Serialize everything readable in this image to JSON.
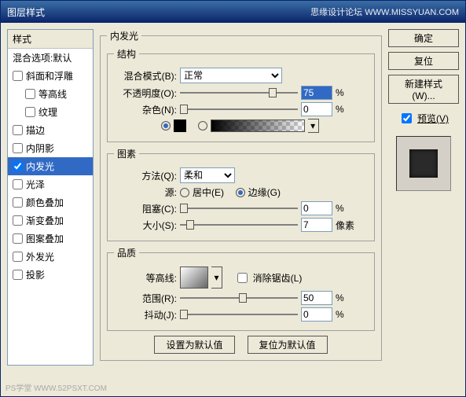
{
  "title": "图层样式",
  "title_right": "思缘设计论坛  WWW.MISSYUAN.COM",
  "styles_header": "样式",
  "blend_options": "混合选项:默认",
  "style_items": [
    {
      "label": "斜面和浮雕",
      "checked": false,
      "indent": false
    },
    {
      "label": "等高线",
      "checked": false,
      "indent": true
    },
    {
      "label": "纹理",
      "checked": false,
      "indent": true
    },
    {
      "label": "描边",
      "checked": false,
      "indent": false
    },
    {
      "label": "内阴影",
      "checked": false,
      "indent": false
    },
    {
      "label": "内发光",
      "checked": true,
      "indent": false,
      "active": true
    },
    {
      "label": "光泽",
      "checked": false,
      "indent": false
    },
    {
      "label": "颜色叠加",
      "checked": false,
      "indent": false
    },
    {
      "label": "渐变叠加",
      "checked": false,
      "indent": false
    },
    {
      "label": "图案叠加",
      "checked": false,
      "indent": false
    },
    {
      "label": "外发光",
      "checked": false,
      "indent": false
    },
    {
      "label": "投影",
      "checked": false,
      "indent": false
    }
  ],
  "main_title": "内发光",
  "group_structure": "结构",
  "blend_mode_label": "混合模式(B):",
  "blend_mode_value": "正常",
  "opacity_label": "不透明度(O):",
  "opacity_value": "75",
  "percent": "%",
  "noise_label": "杂色(N):",
  "noise_value": "0",
  "group_elements": "图素",
  "technique_label": "方法(Q):",
  "technique_value": "柔和",
  "source_label": "源:",
  "source_center": "居中(E)",
  "source_edge": "边缘(G)",
  "choke_label": "阻塞(C):",
  "choke_value": "0",
  "size_label": "大小(S):",
  "size_value": "7",
  "px": "像素",
  "group_quality": "品质",
  "contour_label": "等高线:",
  "anti_alias": "消除锯齿(L)",
  "range_label": "范围(R):",
  "range_value": "50",
  "jitter_label": "抖动(J):",
  "jitter_value": "0",
  "btn_default": "设置为默认值",
  "btn_reset_default": "复位为默认值",
  "btn_ok": "确定",
  "btn_cancel": "复位",
  "btn_new_style": "新建样式(W)...",
  "preview_label": "预览(V)",
  "watermark": "PS学堂  WWW.52PSXT.COM"
}
